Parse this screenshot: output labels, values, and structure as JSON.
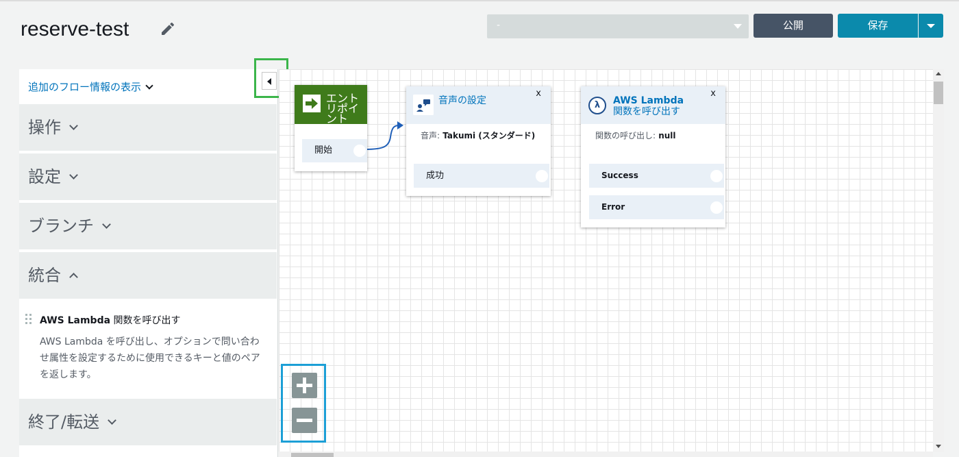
{
  "header": {
    "title": "reserve-test",
    "select_value": "-",
    "publish_label": "公開",
    "save_label": "保存"
  },
  "panel": {
    "flow_info_label": "追加のフロー情報の表示",
    "categories": [
      {
        "label": "操作",
        "expanded": false
      },
      {
        "label": "設定",
        "expanded": false
      },
      {
        "label": "ブランチ",
        "expanded": false
      },
      {
        "label": "統合",
        "expanded": true
      },
      {
        "label": "終了/転送",
        "expanded": false
      }
    ],
    "integration_item": {
      "title_bold": "AWS Lambda",
      "title_rest": " 関数を呼び出す",
      "description": "AWS Lambda を呼び出し、オプションで問い合わせ属性を設定するために使用できるキーと値のペアを返します。"
    }
  },
  "blocks": {
    "entry": {
      "label": "エントリポイント",
      "port": "開始"
    },
    "voice": {
      "title": "音声の設定",
      "close": "x",
      "prop_key": "音声:",
      "prop_value": " Takumi (スタンダード)",
      "port": "成功"
    },
    "lambda": {
      "title_line1": "AWS Lambda",
      "title_line2": "関数を呼び出す",
      "close": "x",
      "icon_glyph": "λ",
      "prop_key": "関数の呼び出し:",
      "prop_value": " null",
      "ports": [
        "Success",
        "Error"
      ]
    }
  },
  "colors": {
    "entry_green": "#3f7b1b",
    "save_blue": "#0b8aac",
    "publish_navy": "#465466",
    "link_blue": "#0073bb",
    "highlight_green": "#3bb54a",
    "highlight_blue": "#1c9fd6"
  },
  "icons": {
    "edit": "pencil-icon",
    "zoom_in": "plus-icon",
    "zoom_out": "minus-icon",
    "voice_block": "speech-person-icon",
    "lambda_block": "lambda-icon",
    "entry_block": "arrow-right-icon"
  }
}
